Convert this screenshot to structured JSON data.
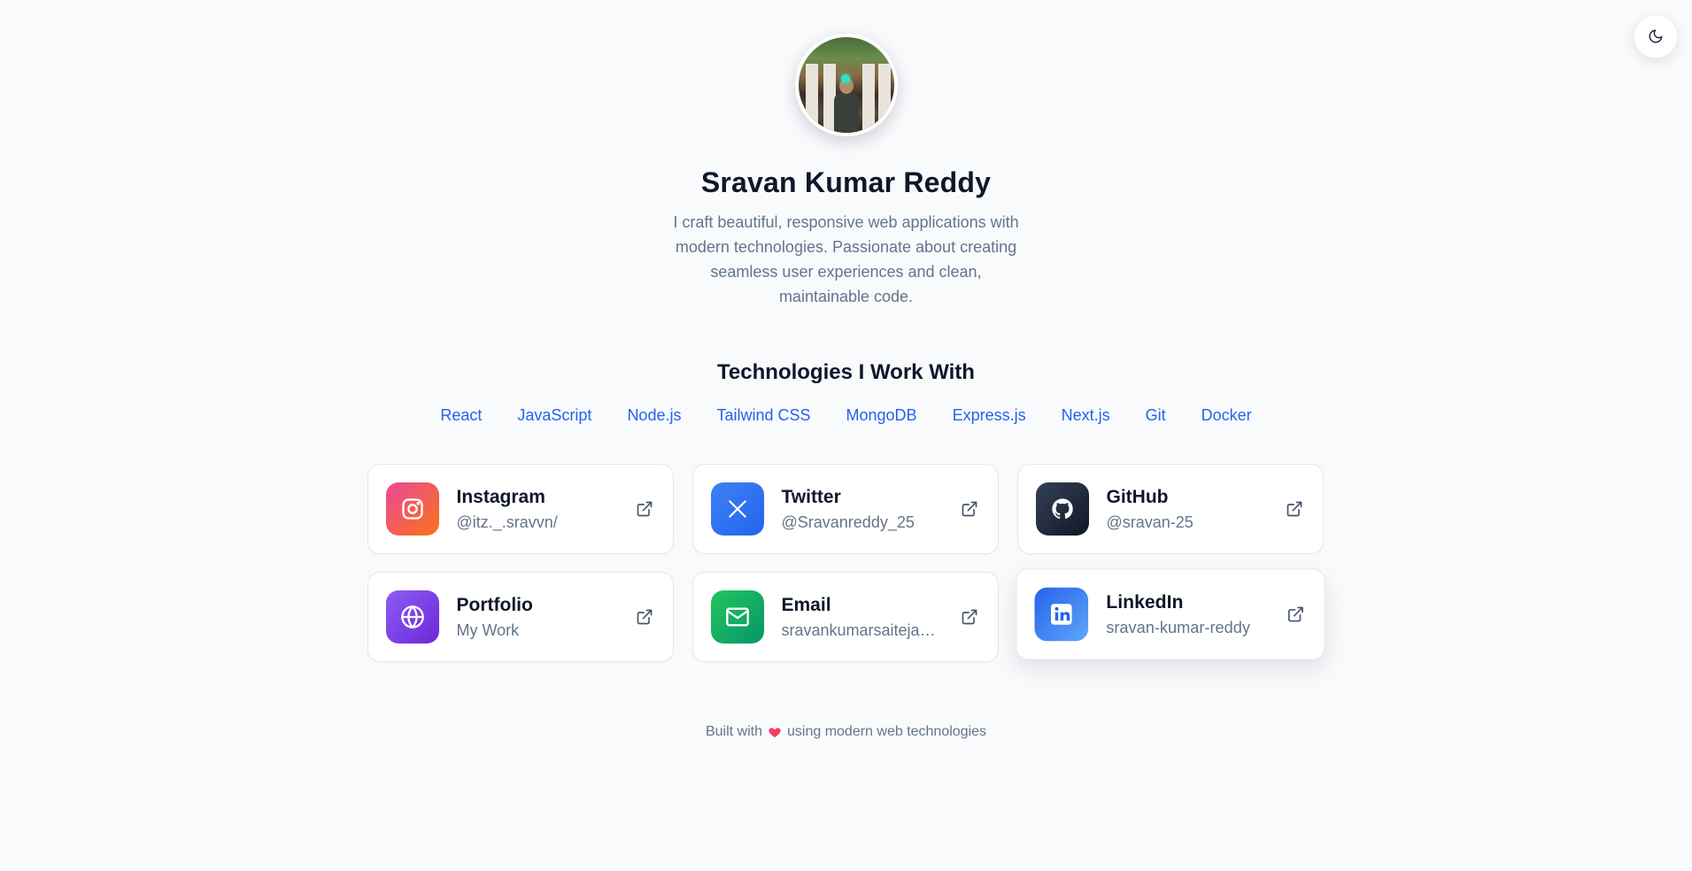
{
  "profile": {
    "name": "Sravan Kumar Reddy",
    "bio": "I craft beautiful, responsive web applications with modern technologies. Passionate about creating seamless user experiences and clean, maintainable code."
  },
  "technologies": {
    "heading": "Technologies I Work With",
    "items": [
      "React",
      "JavaScript",
      "Node.js",
      "Tailwind CSS",
      "MongoDB",
      "Express.js",
      "Next.js",
      "Git",
      "Docker"
    ]
  },
  "links": [
    {
      "title": "Instagram",
      "handle": "@itz._.sravvn/",
      "icon": "instagram-icon",
      "color": "#f43f5e"
    },
    {
      "title": "Twitter",
      "handle": "@Sravanreddy_25",
      "icon": "x-icon",
      "color": "#3b82f6"
    },
    {
      "title": "GitHub",
      "handle": "@sravan-25",
      "icon": "github-icon",
      "color": "#1f2937"
    },
    {
      "title": "Portfolio",
      "handle": "My Work",
      "icon": "globe-icon",
      "color": "#7c3aed"
    },
    {
      "title": "Email",
      "handle": "sravankumarsaiteja@gmail.com",
      "icon": "mail-icon",
      "color": "#16a34a"
    },
    {
      "title": "LinkedIn",
      "handle": "sravan-kumar-reddy",
      "icon": "linkedin-icon",
      "color": "#2563eb"
    }
  ],
  "footer": {
    "before": "Built with",
    "after": "using modern web technologies"
  },
  "theme": {
    "toggle_icon": "moon-icon"
  }
}
